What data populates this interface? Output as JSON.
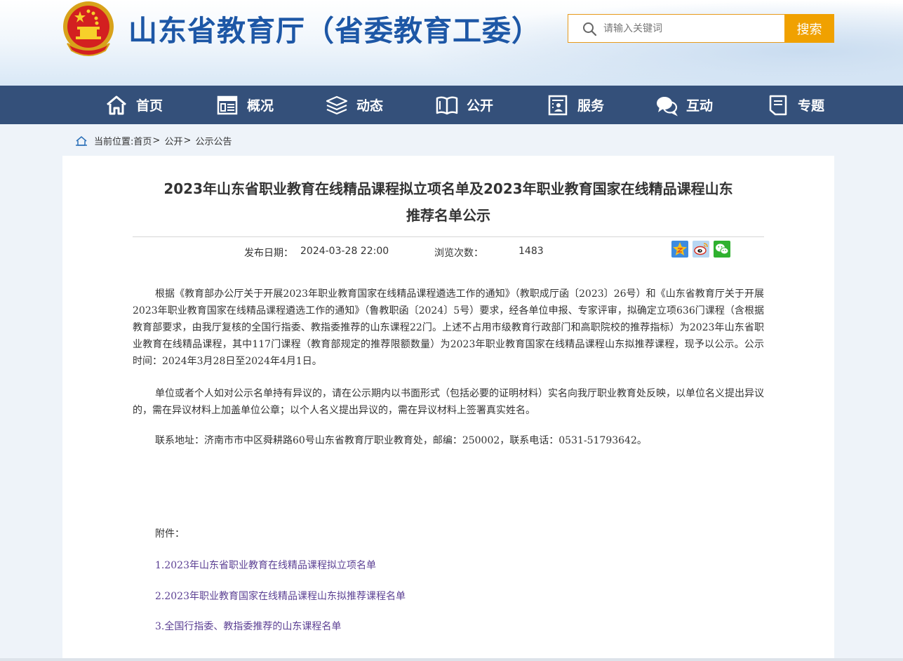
{
  "header": {
    "site_title": "山东省教育厅（省委教育工委）",
    "search_placeholder": "请输入关键词",
    "search_button": "搜索"
  },
  "nav": {
    "items": [
      {
        "label": "首页",
        "icon": "home-icon"
      },
      {
        "label": "概况",
        "icon": "overview-icon"
      },
      {
        "label": "动态",
        "icon": "news-stack-icon"
      },
      {
        "label": "公开",
        "icon": "open-book-icon"
      },
      {
        "label": "服务",
        "icon": "service-icon"
      },
      {
        "label": "互动",
        "icon": "chat-icon"
      },
      {
        "label": "专题",
        "icon": "topic-icon"
      }
    ]
  },
  "breadcrumb": {
    "prefix": "当前位置:",
    "items": [
      "首页",
      "公开",
      "公示公告"
    ],
    "separator": ">"
  },
  "article": {
    "title_line1": "2023年山东省职业教育在线精品课程拟立项名单及2023年职业教育国家在线精品课程山东",
    "title_line2": "推荐名单公示",
    "publish_label": "发布日期：",
    "publish_date": "2024-03-28 22:00",
    "views_label": "浏览次数：",
    "views": "1483",
    "paragraphs": [
      "根据《教育部办公厅关于开展2023年职业教育国家在线精品课程遴选工作的通知》（教职成厅函〔2023〕26号）和《山东省教育厅关于开展2023年职业教育国家在线精品课程遴选工作的通知》（鲁教职函〔2024〕5号）要求，经各单位申报、专家评审，拟确定立项636门课程（含根据教育部要求，由我厅复核的全国行指委、教指委推荐的山东课程22门。上述不占用市级教育行政部门和高职院校的推荐指标）为2023年山东省职业教育在线精品课程，其中117门课程（教育部规定的推荐限额数量）为2023年职业教育国家在线精品课程山东拟推荐课程，现予以公示。公示时间：2024年3月28日至2024年4月1日。",
      "单位或者个人如对公示名单持有异议的，请在公示期内以书面形式（包括必要的证明材料）实名向我厅职业教育处反映，以单位名义提出异议的，需在异议材料上加盖单位公章；以个人名义提出异议的，需在异议材料上签署真实姓名。",
      "联系地址：济南市市中区舜耕路60号山东省教育厅职业教育处，邮编：250002，联系电话：0531-51793642。"
    ],
    "attachments_label": "附件：",
    "attachments": [
      "1.2023年山东省职业教育在线精品课程拟立项名单",
      "2.2023年职业教育国家在线精品课程山东拟推荐课程名单",
      "3.全国行指委、教指委推荐的山东课程名单"
    ]
  },
  "colors": {
    "title_blue": "#1d57a6",
    "nav_bg": "#34507a",
    "search_orange": "#f0a100",
    "link_purple": "#5b3f93"
  }
}
